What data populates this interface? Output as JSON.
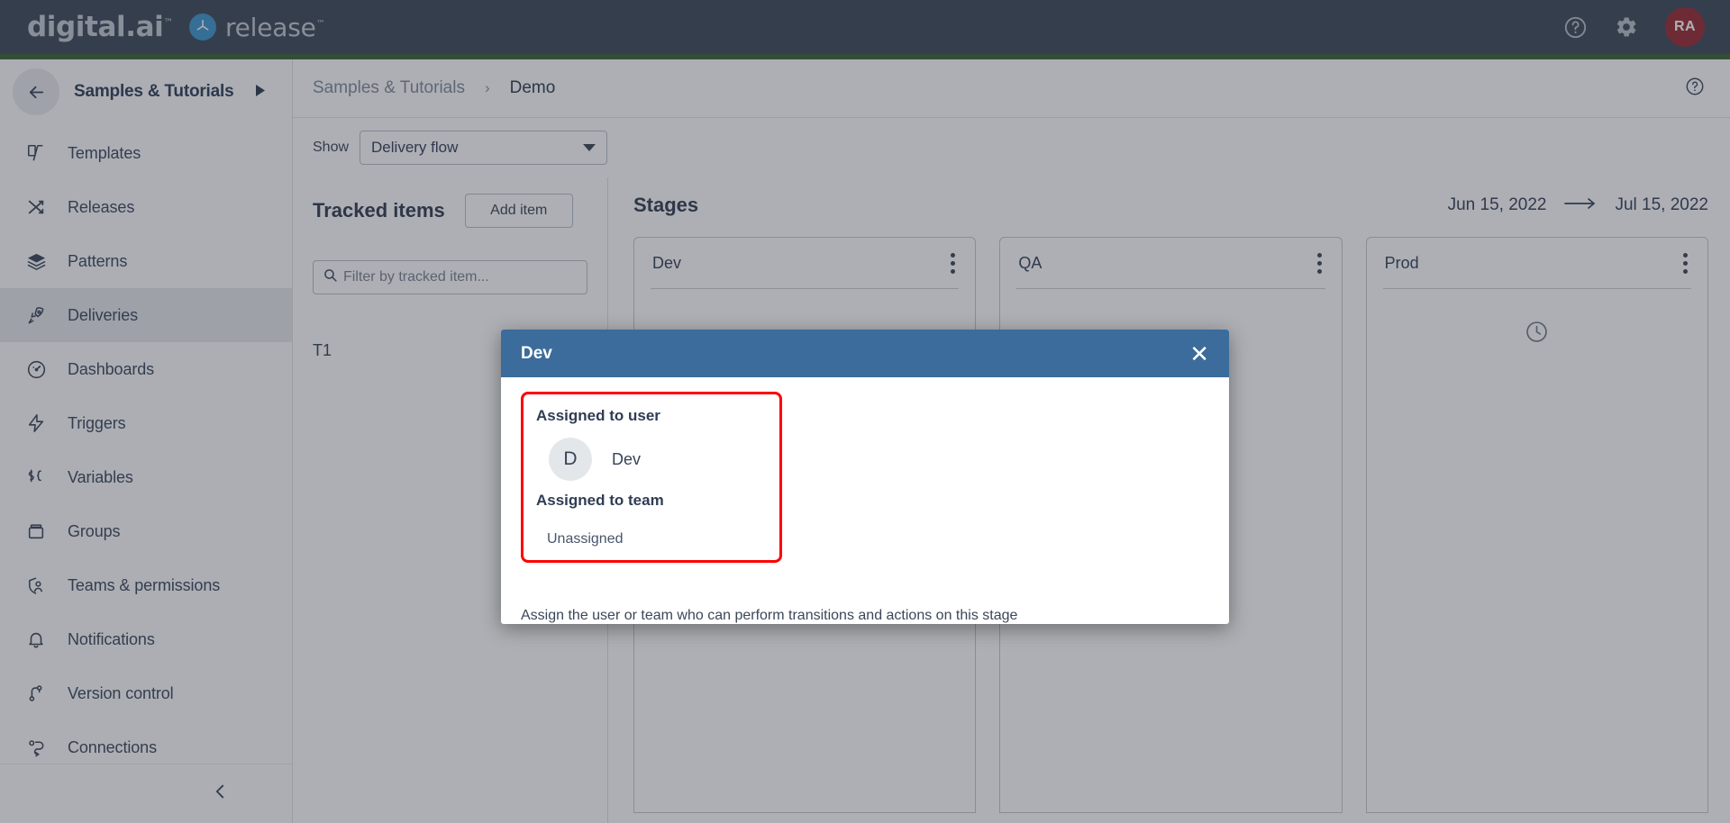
{
  "topbar": {
    "brand_primary": "digital.ai",
    "brand_tm": "™",
    "brand_secondary": "release",
    "brand_secondary_tm": "™",
    "help_icon": "help-circle-icon",
    "settings_icon": "gear-icon",
    "avatar_initials": "RA",
    "accent_green": "#3d6234",
    "bar_color": "#3e4a5a",
    "avatar_color": "#9c2a33"
  },
  "sidebar": {
    "project": "Samples & Tutorials",
    "back_icon": "arrow-left-icon",
    "expand_icon": "caret-right-icon",
    "collapse_icon": "chevron-left-icon",
    "items": [
      {
        "label": "Templates",
        "icon": "templates-icon",
        "active": false
      },
      {
        "label": "Releases",
        "icon": "shuffle-icon",
        "active": false
      },
      {
        "label": "Patterns",
        "icon": "layers-icon",
        "active": false
      },
      {
        "label": "Deliveries",
        "icon": "rocket-icon",
        "active": true
      },
      {
        "label": "Dashboards",
        "icon": "gauge-icon",
        "active": false
      },
      {
        "label": "Triggers",
        "icon": "bolt-icon",
        "active": false
      },
      {
        "label": "Variables",
        "icon": "variable-icon",
        "active": false
      },
      {
        "label": "Groups",
        "icon": "box-icon",
        "active": false
      },
      {
        "label": "Teams & permissions",
        "icon": "team-shield-icon",
        "active": false
      },
      {
        "label": "Notifications",
        "icon": "bell-icon",
        "active": false
      },
      {
        "label": "Version control",
        "icon": "branch-icon",
        "active": false
      },
      {
        "label": "Connections",
        "icon": "plug-icon",
        "active": false
      }
    ]
  },
  "breadcrumb": {
    "parent": "Samples & Tutorials",
    "separator": "›",
    "current": "Demo",
    "help_icon": "help-circle-icon"
  },
  "show": {
    "label": "Show",
    "selected": "Delivery flow",
    "options": [
      "Delivery flow"
    ]
  },
  "tracked": {
    "title": "Tracked items",
    "add_label": "Add item",
    "filter_placeholder": "Filter by tracked item...",
    "filter_value": "",
    "search_icon": "search-icon",
    "rows": [
      "T1"
    ]
  },
  "stages": {
    "title": "Stages",
    "start_date": "Jun 15, 2022",
    "arrow": "→",
    "end_date": "Jul 15, 2022",
    "columns": [
      {
        "name": "Dev",
        "menu_icon": "kebab-menu-icon",
        "status_icon": ""
      },
      {
        "name": "QA",
        "menu_icon": "kebab-menu-icon",
        "status_icon": ""
      },
      {
        "name": "Prod",
        "menu_icon": "kebab-menu-icon",
        "status_icon": "clock-icon"
      }
    ]
  },
  "modal": {
    "title": "Dev",
    "close_icon": "close-x-icon",
    "header_color": "#3b6c9b",
    "highlight_color": "#ff0000",
    "assigned_user_label": "Assigned to user",
    "assigned_user_initial": "D",
    "assigned_user_name": "Dev",
    "assigned_team_label": "Assigned to team",
    "assigned_team_value": "Unassigned",
    "note": "Assign the user or team who can perform transitions and actions on this stage"
  }
}
